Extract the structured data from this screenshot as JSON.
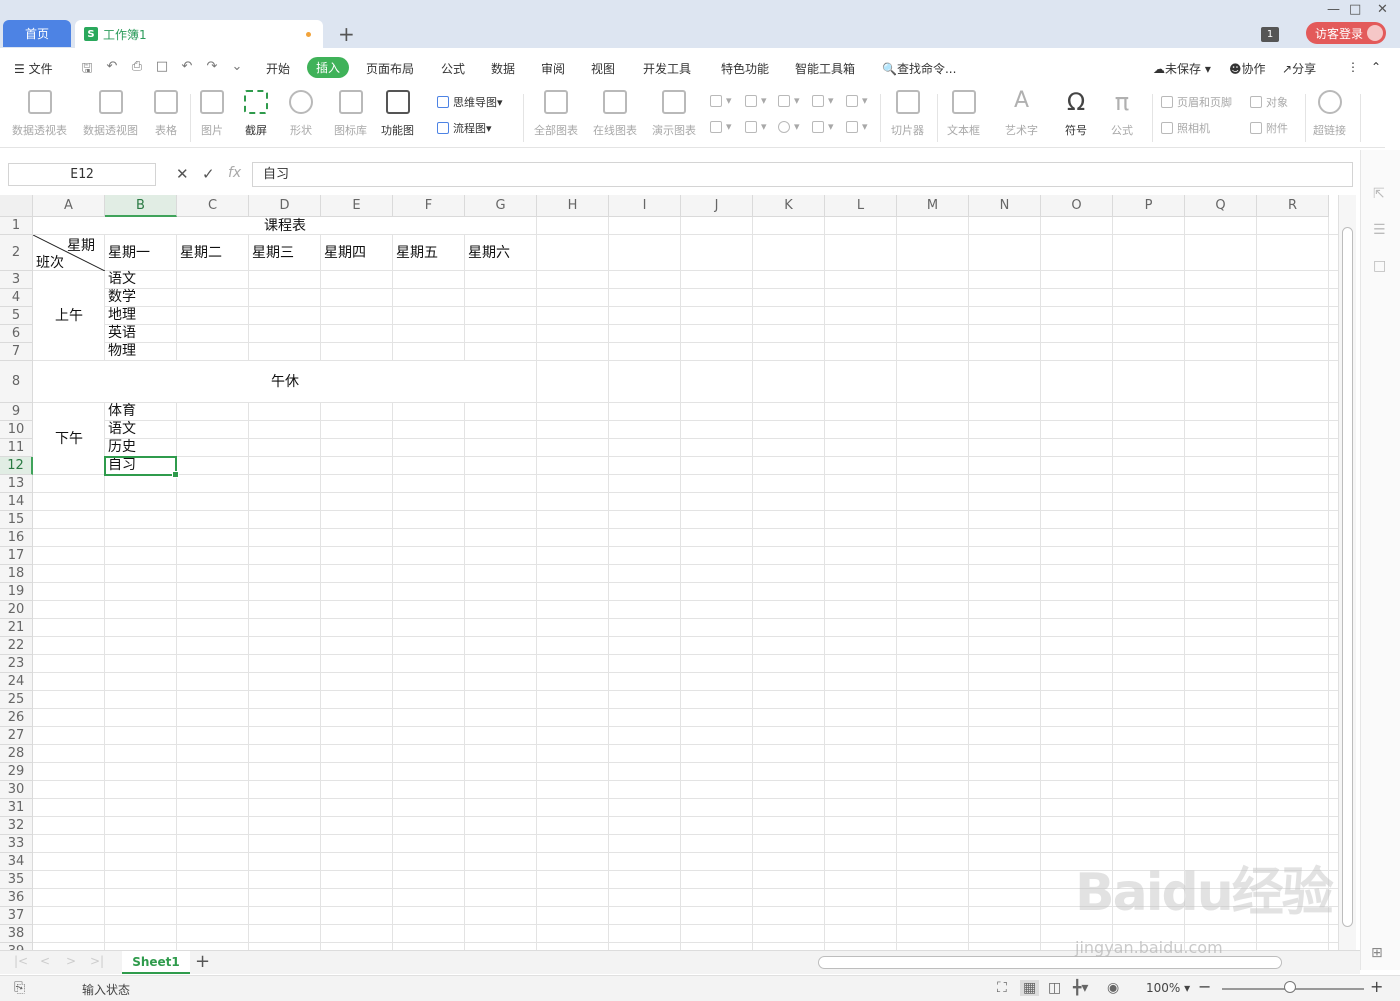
{
  "titlebar": {
    "home_tab": "首页",
    "doc_tab": "工作簿1",
    "doc_icon_letter": "S",
    "badge": "1",
    "login": "访客登录"
  },
  "menubar": {
    "file": "文件",
    "items": [
      "开始",
      "插入",
      "页面布局",
      "公式",
      "数据",
      "审阅",
      "视图",
      "开发工具",
      "特色功能",
      "智能工具箱"
    ],
    "active_item": "插入",
    "search": "查找命令...",
    "right": [
      "未保存",
      "协作",
      "分享"
    ]
  },
  "ribbon": {
    "pivot_table": "数据透视表",
    "pivot_chart": "数据透视图",
    "table": "表格",
    "picture": "图片",
    "screenshot": "截屏",
    "shapes": "形状",
    "icon_lib": "图标库",
    "func_chart": "功能图",
    "mindmap": "思维导图",
    "flowchart": "流程图",
    "all_charts": "全部图表",
    "online_charts": "在线图表",
    "demo_charts": "演示图表",
    "slicer": "切片器",
    "textbox": "文本框",
    "wordart": "艺术字",
    "symbol": "符号",
    "formula": "公式",
    "header_footer": "页眉和页脚",
    "object": "对象",
    "camera": "照相机",
    "attachment": "附件",
    "hyperlink": "超链接"
  },
  "formula_bar": {
    "cell_ref": "E12",
    "fx": "fx",
    "content": "自习"
  },
  "sheet": {
    "columns": [
      "A",
      "B",
      "C",
      "D",
      "E",
      "F",
      "G",
      "H",
      "I",
      "J",
      "K",
      "L",
      "M",
      "N",
      "O",
      "P",
      "Q",
      "R"
    ],
    "selected_col": "B",
    "selected_row": "12",
    "rows": [
      "1",
      "2",
      "3",
      "4",
      "5",
      "6",
      "7",
      "8",
      "9",
      "10",
      "11",
      "12",
      "13",
      "14",
      "15",
      "16",
      "17",
      "18",
      "19",
      "20",
      "21",
      "22",
      "23",
      "24",
      "25",
      "26",
      "27",
      "28",
      "29",
      "30",
      "31",
      "32",
      "33",
      "34",
      "35",
      "36",
      "37",
      "38",
      "39"
    ],
    "title": "课程表",
    "corner_top": "星期",
    "corner_bottom": "班次",
    "weekdays": [
      "星期一",
      "星期二",
      "星期三",
      "星期四",
      "星期五",
      "星期六"
    ],
    "morning_label": "上午",
    "morning_subjects": [
      "语文",
      "数学",
      "地理",
      "英语",
      "物理"
    ],
    "noon_label": "午休",
    "afternoon_label": "下午",
    "afternoon_subjects": [
      "体育",
      "语文",
      "历史",
      "自习"
    ]
  },
  "sheet_tabs": {
    "active": "Sheet1",
    "add": "+"
  },
  "status": {
    "mode": "输入状态",
    "zoom": "100%"
  },
  "watermark": {
    "logo": "Baidu经验",
    "url": "jingyan.baidu.com"
  }
}
